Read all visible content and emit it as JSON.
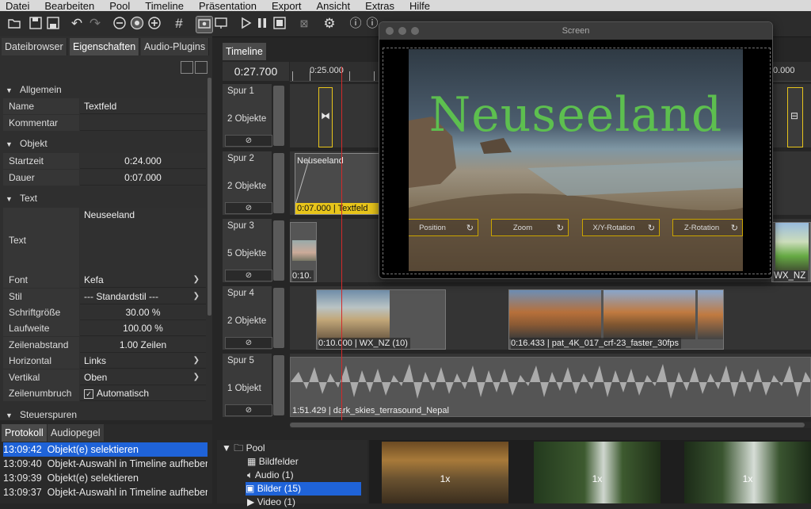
{
  "menu": [
    "Datei",
    "Bearbeiten",
    "Pool",
    "Timeline",
    "Präsentation",
    "Export",
    "Ansicht",
    "Extras",
    "Hilfe"
  ],
  "toolbar": {
    "icons": [
      "open-folder-icon",
      "save-icon",
      "save-as-icon",
      "undo-icon",
      "redo-icon",
      "zoom-out-icon",
      "zoom-star-icon",
      "zoom-in-icon",
      "grid-icon",
      "preview-eye-icon",
      "screen-icon",
      "play-icon",
      "pause-icon",
      "stop-icon",
      "close-x-icon",
      "settings-gear-icon",
      "help-icon",
      "info-icon"
    ]
  },
  "left_tabs": [
    "Dateibrowser",
    "Eigenschaften",
    "Audio-Plugins"
  ],
  "sections": {
    "allgemein": "Allgemein",
    "objekt": "Objekt",
    "text": "Text",
    "steuerspuren": "Steuerspuren"
  },
  "props": {
    "name_label": "Name",
    "name_value": "Textfeld",
    "kommentar_label": "Kommentar",
    "kommentar_value": "",
    "startzeit_label": "Startzeit",
    "startzeit_value": "0:24.000",
    "dauer_label": "Dauer",
    "dauer_value": "0:07.000",
    "text_label": "Text",
    "text_value": "Neuseeland",
    "font_label": "Font",
    "font_value": "Kefa",
    "stil_label": "Stil",
    "stil_value": "--- Standardstil ---",
    "schriftgroesse_label": "Schriftgröße",
    "schriftgroesse_value": "30.00 %",
    "laufweite_label": "Laufweite",
    "laufweite_value": "100.00 %",
    "zeilenabstand_label": "Zeilenabstand",
    "zeilenabstand_value": "1.00 Zeilen",
    "horizontal_label": "Horizontal",
    "horizontal_value": "Links",
    "vertikal_label": "Vertikal",
    "vertikal_value": "Oben",
    "zeilenumbruch_label": "Zeilenumbruch",
    "zeilenumbruch_value": "Automatisch"
  },
  "bottom_tabs": [
    "Protokoll",
    "Audiopegel"
  ],
  "log": [
    {
      "time": "13:09:42",
      "text": "Objekt(e) selektieren",
      "selected": true
    },
    {
      "time": "13:09:40",
      "text": "Objekt-Auswahl in Timeline aufheben",
      "selected": false
    },
    {
      "time": "13:09:39",
      "text": "Objekt(e) selektieren",
      "selected": false
    },
    {
      "time": "13:09:37",
      "text": "Objekt-Auswahl in Timeline aufheben",
      "selected": false
    }
  ],
  "timeline": {
    "tab": "Timeline",
    "timecode": "0:27.700",
    "ruler": [
      "0:25.000",
      "0.000"
    ],
    "tracks": [
      {
        "name": "Spur 1",
        "count": "2 Objekte"
      },
      {
        "name": "Spur 2",
        "count": "2 Objekte"
      },
      {
        "name": "Spur 3",
        "count": "5 Objekte"
      },
      {
        "name": "Spur 4",
        "count": "2 Objekte"
      },
      {
        "name": "Spur 5",
        "count": "1 Objekt"
      }
    ],
    "clips": {
      "textfeld_title": "Neuseeland",
      "textfeld_label": "0:07.000 | Textfeld",
      "spur3_label": "0:10.",
      "spur3_right_label": "WX_NZ",
      "spur4_a": "0:10.000 | WX_NZ (10)",
      "spur4_b": "0:16.433 | pat_4K_017_crf-23_faster_30fps",
      "spur5": "1:51.429 | dark_skies_terrasound_Nepal"
    }
  },
  "screen": {
    "title": "Screen",
    "headline": "Neuseeland",
    "controls": [
      "Position",
      "Zoom",
      "X/Y-Rotation",
      "Z-Rotation"
    ]
  },
  "pool": {
    "root": "Pool",
    "items": [
      {
        "label": "Bildfelder",
        "icon": "grid-icon",
        "selected": false
      },
      {
        "label": "Audio (1)",
        "icon": "speaker-icon",
        "selected": false
      },
      {
        "label": "Bilder (15)",
        "icon": "image-icon",
        "selected": true
      },
      {
        "label": "Video (1)",
        "icon": "video-icon",
        "selected": false
      }
    ],
    "thumb_counts": [
      "1x",
      "1x",
      "1x"
    ]
  },
  "colors": {
    "accent": "#1f63d8",
    "playhead": "#d22a2a",
    "title_green": "#5dbf4f",
    "textclip_yellow": "#e8c51b"
  }
}
